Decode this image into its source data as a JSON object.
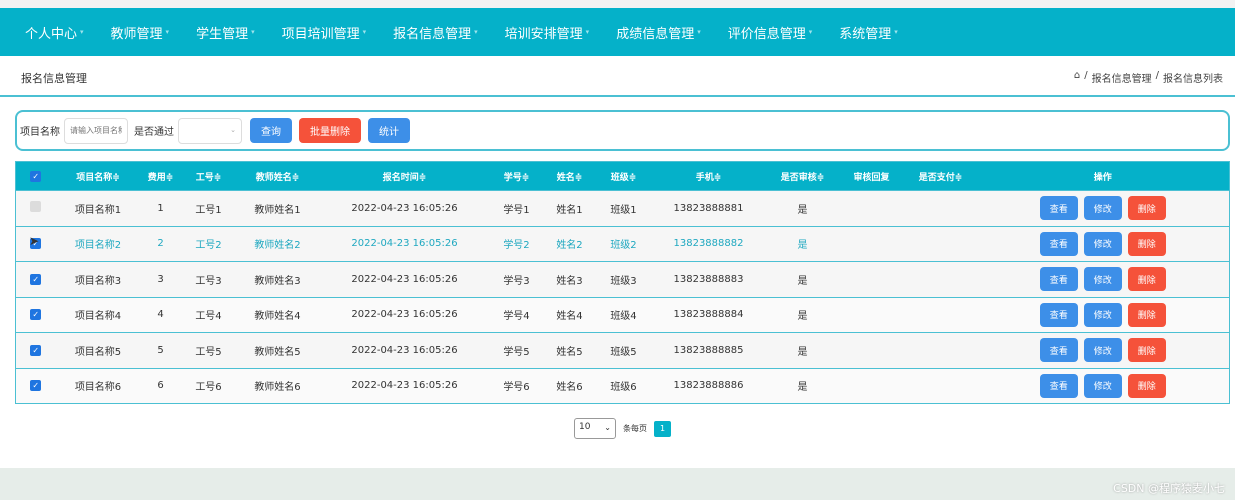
{
  "nav": [
    "个人中心",
    "教师管理",
    "学生管理",
    "项目培训管理",
    "报名信息管理",
    "培训安排管理",
    "成绩信息管理",
    "评价信息管理",
    "系统管理"
  ],
  "header": {
    "title": "报名信息管理",
    "breadcrumb": [
      "报名信息管理",
      "报名信息列表"
    ]
  },
  "search": {
    "name_label": "项目名称",
    "name_placeholder": "请输入项目名称",
    "pass_label": "是否通过",
    "pass_value": "",
    "query": "查询",
    "batch_delete": "批量删除",
    "stats": "统计"
  },
  "table": {
    "headers": [
      "项目名称≑",
      "费用≑",
      "工号≑",
      "教师姓名≑",
      "报名时间≑",
      "学号≑",
      "姓名≑",
      "班级≑",
      "手机≑",
      "是否审核≑",
      "审核回复",
      "是否支付≑",
      "操作"
    ],
    "rows": [
      [
        "项目名称1",
        "1",
        "工号1",
        "教师姓名1",
        "2022-04-23 16:05:26",
        "学号1",
        "姓名1",
        "班级1",
        "13823888881",
        "是",
        "",
        ""
      ],
      [
        "项目名称2",
        "2",
        "工号2",
        "教师姓名2",
        "2022-04-23 16:05:26",
        "学号2",
        "姓名2",
        "班级2",
        "13823888882",
        "是",
        "",
        ""
      ],
      [
        "项目名称3",
        "3",
        "工号3",
        "教师姓名3",
        "2022-04-23 16:05:26",
        "学号3",
        "姓名3",
        "班级3",
        "13823888883",
        "是",
        "",
        ""
      ],
      [
        "项目名称4",
        "4",
        "工号4",
        "教师姓名4",
        "2022-04-23 16:05:26",
        "学号4",
        "姓名4",
        "班级4",
        "13823888884",
        "是",
        "",
        ""
      ],
      [
        "项目名称5",
        "5",
        "工号5",
        "教师姓名5",
        "2022-04-23 16:05:26",
        "学号5",
        "姓名5",
        "班级5",
        "13823888885",
        "是",
        "",
        ""
      ],
      [
        "项目名称6",
        "6",
        "工号6",
        "教师姓名6",
        "2022-04-23 16:05:26",
        "学号6",
        "姓名6",
        "班级6",
        "13823888886",
        "是",
        "",
        ""
      ]
    ],
    "checked": [
      false,
      true,
      true,
      true,
      true,
      true
    ],
    "actions": {
      "view": "查看",
      "edit": "修改",
      "delete": "删除"
    }
  },
  "pagination": {
    "page_size": "10",
    "per_page_label": "条每页",
    "current_page": "1"
  },
  "watermark": "CSDN @程序猿麦小七",
  "colors": {
    "primary": "#05b1c9",
    "button_blue": "#3d8fe8",
    "button_red": "#f5523a"
  }
}
